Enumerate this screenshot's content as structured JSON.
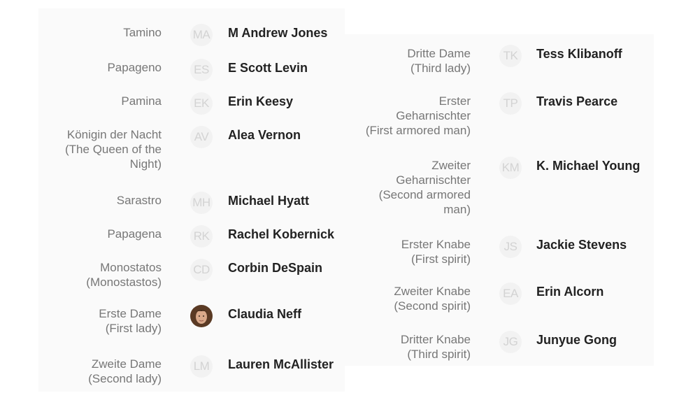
{
  "left_column": [
    {
      "role": "Tamino",
      "initials": "MA",
      "name": "M Andrew Jones"
    },
    {
      "role": "Papageno",
      "initials": "ES",
      "name": "E Scott Levin"
    },
    {
      "role": "Pamina",
      "initials": "EK",
      "name": "Erin Keesy"
    },
    {
      "role": "Königin der Nacht\n(The Queen of the\nNight)",
      "initials": "AV",
      "name": "Alea Vernon"
    },
    {
      "role": "Sarastro",
      "initials": "MH",
      "name": "Michael Hyatt"
    },
    {
      "role": "Papagena",
      "initials": "RK",
      "name": "Rachel Kobernick"
    },
    {
      "role": "Monostatos\n(Monostastos)",
      "initials": "CD",
      "name": "Corbin DeSpain"
    },
    {
      "role": "Erste Dame\n(First lady)",
      "initials": "",
      "name": "Claudia Neff",
      "avatar": "photo"
    },
    {
      "role": "Zweite Dame\n(Second lady)",
      "initials": "LM",
      "name": "Lauren McAllister"
    }
  ],
  "right_column": [
    {
      "role": "Dritte Dame\n(Third lady)",
      "initials": "TK",
      "name": "Tess Klibanoff"
    },
    {
      "role": "Erster\nGeharnischter\n(First armored man)",
      "initials": "TP",
      "name": "Travis Pearce"
    },
    {
      "role": "Zweiter\nGeharnischter\n(Second armored\nman)",
      "initials": "KM",
      "name": "K. Michael Young"
    },
    {
      "role": "Erster Knabe\n(First spirit)",
      "initials": "JS",
      "name": "Jackie Stevens"
    },
    {
      "role": "Zweiter Knabe\n(Second spirit)",
      "initials": "EA",
      "name": "Erin Alcorn"
    },
    {
      "role": "Dritter Knabe\n(Third spirit)",
      "initials": "JG",
      "name": "Junyue Gong"
    }
  ]
}
